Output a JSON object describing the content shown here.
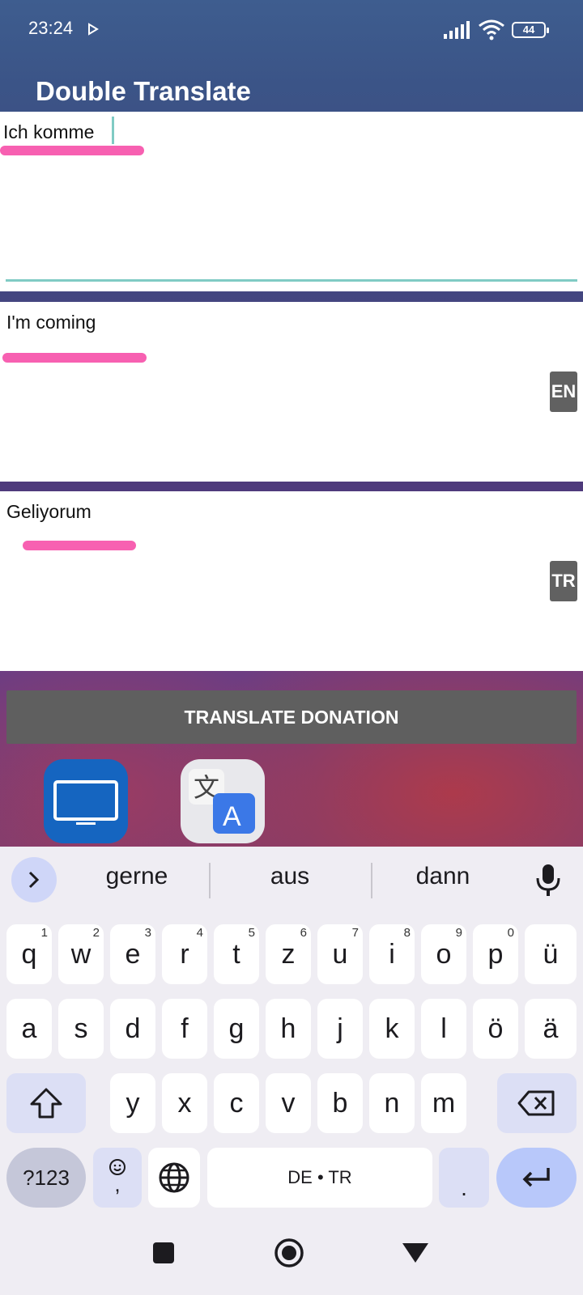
{
  "status_bar": {
    "time": "23:24",
    "battery": "44"
  },
  "app": {
    "title": "Double Translate",
    "source_text": "Ich komme",
    "translation1": {
      "text": "I'm coming",
      "lang": "EN"
    },
    "translation2": {
      "text": "Geliyorum",
      "lang": "TR"
    },
    "donate_label": "TRANSLATE DONATION"
  },
  "keyboard": {
    "suggestions": [
      "gerne",
      "aus",
      "dann"
    ],
    "row1": [
      {
        "label": "q",
        "hint": "1"
      },
      {
        "label": "w",
        "hint": "2"
      },
      {
        "label": "e",
        "hint": "3"
      },
      {
        "label": "r",
        "hint": "4"
      },
      {
        "label": "t",
        "hint": "5"
      },
      {
        "label": "z",
        "hint": "6"
      },
      {
        "label": "u",
        "hint": "7"
      },
      {
        "label": "i",
        "hint": "8"
      },
      {
        "label": "o",
        "hint": "9"
      },
      {
        "label": "p",
        "hint": "0"
      },
      {
        "label": "ü",
        "hint": ""
      }
    ],
    "row2": [
      "a",
      "s",
      "d",
      "f",
      "g",
      "h",
      "j",
      "k",
      "l",
      "ö",
      "ä"
    ],
    "row3": [
      "y",
      "x",
      "c",
      "v",
      "b",
      "n",
      "m"
    ],
    "symbols_label": "?123",
    "emoji_comma": ",",
    "space_label": "DE • TR",
    "period_label": "."
  },
  "colors": {
    "highlight": "#f760b1",
    "accent_underline": "#80cbc4",
    "button": "#5f5f5f",
    "badge": "#616161"
  }
}
